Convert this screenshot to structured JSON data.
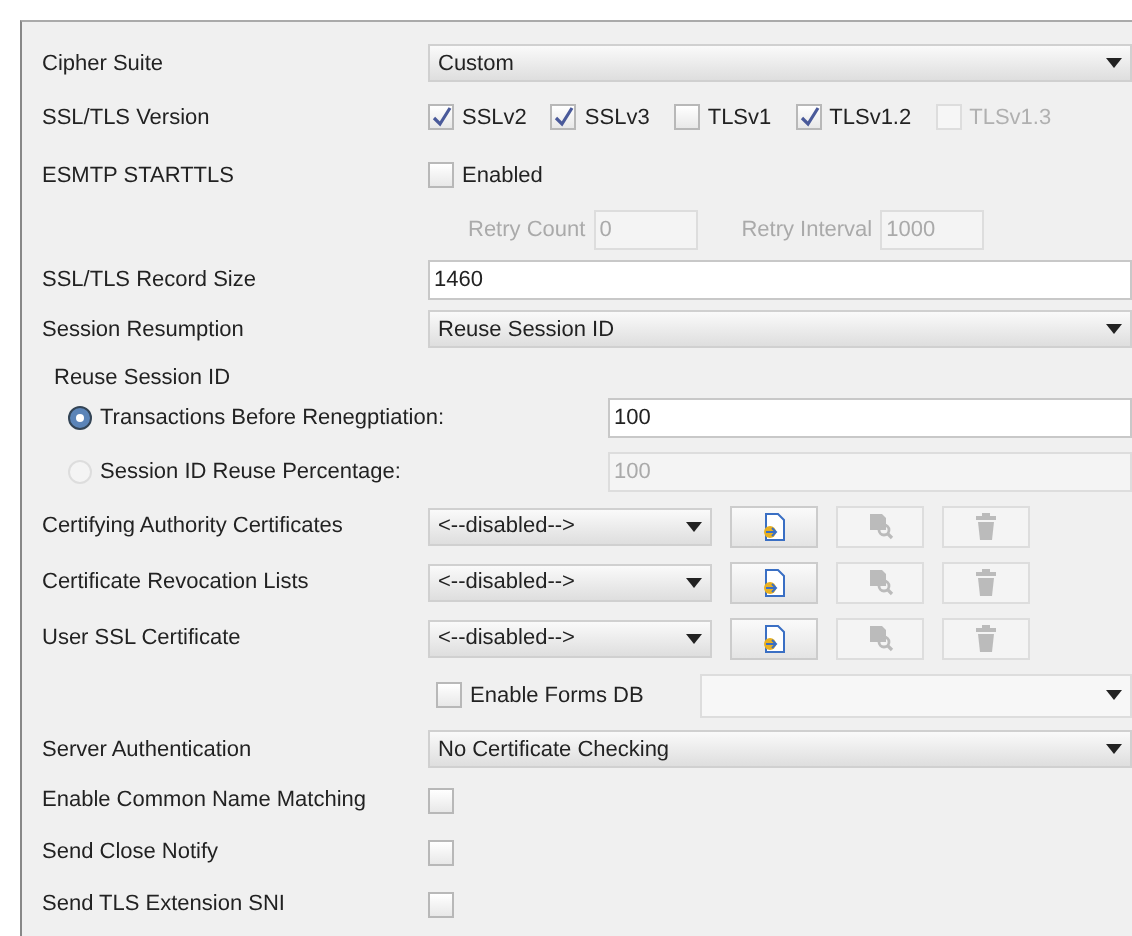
{
  "form": {
    "rows": [
      {
        "kind": "select",
        "label": "Cipher Suite",
        "value": "Custom"
      },
      {
        "kind": "checks",
        "label": "SSL/TLS Version",
        "options": [
          {
            "label": "SSLv2",
            "checked": true,
            "disabled": false
          },
          {
            "label": "SSLv3",
            "checked": true,
            "disabled": false
          },
          {
            "label": "TLSv1",
            "checked": false,
            "disabled": false
          },
          {
            "label": "TLSv1.2",
            "checked": true,
            "disabled": false
          },
          {
            "label": "TLSv1.3",
            "checked": false,
            "disabled": true
          }
        ]
      },
      {
        "kind": "checks",
        "label": "ESMTP STARTTLS",
        "options": [
          {
            "label": "Enabled",
            "checked": false,
            "disabled": false
          }
        ]
      },
      {
        "kind": "fields",
        "fields": [
          {
            "label": "Retry Count",
            "value": "0",
            "disabled": true
          },
          {
            "label": "Retry Interval",
            "value": "1000",
            "disabled": true
          }
        ]
      },
      {
        "kind": "input",
        "label": "SSL/TLS Record Size",
        "value": "1460"
      },
      {
        "kind": "select",
        "label": "Session Resumption",
        "value": "Reuse Session ID"
      },
      {
        "kind": "group",
        "title": "Reuse Session ID",
        "options": [
          {
            "label": "Transactions Before Renegptiation:",
            "selected": true,
            "value": "100"
          },
          {
            "label": "Session ID Reuse Percentage:",
            "selected": false,
            "value": "100"
          }
        ]
      },
      {
        "kind": "cert",
        "label": "Certifying Authority Certificates",
        "value": "<--disabled-->",
        "buttons": [
          {
            "kind": "import",
            "disabled": false
          },
          {
            "kind": "view",
            "disabled": true
          },
          {
            "kind": "delete",
            "disabled": true
          }
        ]
      },
      {
        "kind": "cert",
        "label": "Certificate Revocation Lists",
        "value": "<--disabled-->",
        "buttons": [
          {
            "kind": "import",
            "disabled": false
          },
          {
            "kind": "view",
            "disabled": true
          },
          {
            "kind": "delete",
            "disabled": true
          }
        ]
      },
      {
        "kind": "cert",
        "label": "User SSL Certificate",
        "value": "<--disabled-->",
        "buttons": [
          {
            "kind": "import",
            "disabled": false
          },
          {
            "kind": "view",
            "disabled": true
          },
          {
            "kind": "delete",
            "disabled": true
          }
        ]
      },
      {
        "kind": "forms",
        "option": {
          "label": "Enable Forms DB",
          "checked": false
        }
      },
      {
        "kind": "select",
        "label": "Server Authentication",
        "value": "No Certificate Checking"
      },
      {
        "kind": "box",
        "label": "Enable Common Name Matching",
        "checked": false
      },
      {
        "kind": "box",
        "label": "Send Close Notify",
        "checked": false
      },
      {
        "kind": "box",
        "label": "Send TLS Extension SNI",
        "checked": false
      }
    ]
  }
}
